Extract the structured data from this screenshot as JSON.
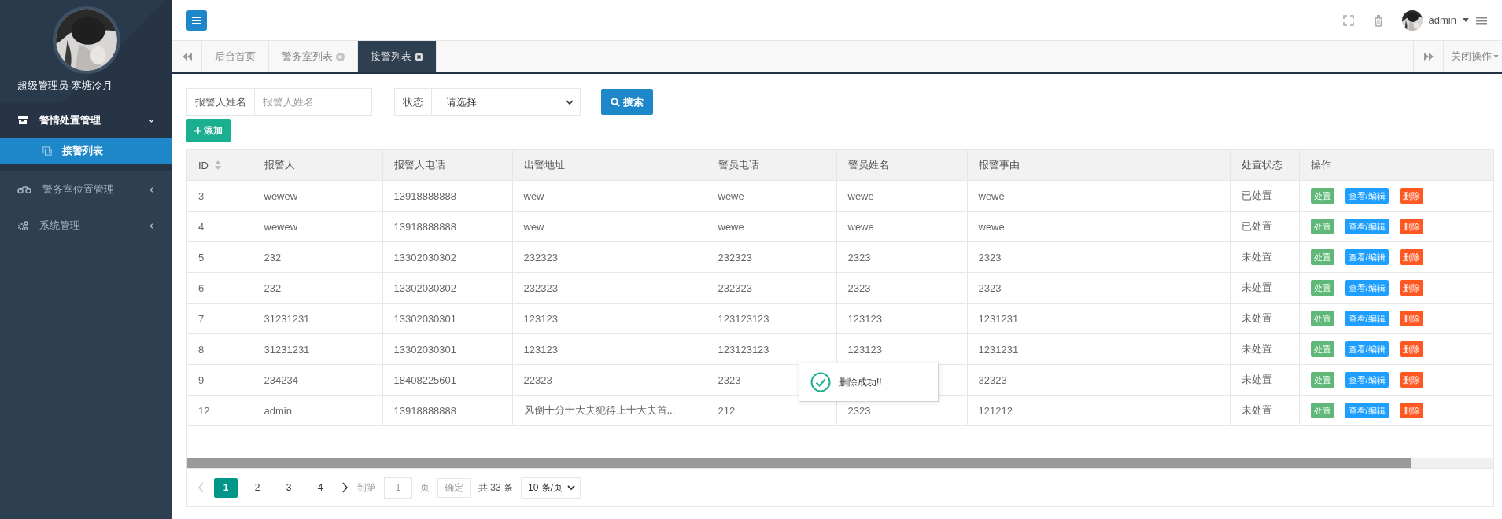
{
  "sidebar": {
    "user_name": "超级管理员-寒塘冷月",
    "menu": [
      {
        "label": "警情处置管理",
        "expanded": true,
        "children": [
          {
            "label": "接警列表",
            "selected": true
          }
        ]
      },
      {
        "label": "警务室位置管理",
        "expanded": false
      },
      {
        "label": "系统管理",
        "expanded": false
      }
    ]
  },
  "header": {
    "user": "admin"
  },
  "tabs": [
    {
      "label": "后台首页",
      "selected": false,
      "closable": false
    },
    {
      "label": "警务室列表",
      "selected": false,
      "closable": true
    },
    {
      "label": "接警列表",
      "selected": true,
      "closable": true
    }
  ],
  "tab_actions": "关闭操作",
  "filters": {
    "name_label": "报警人姓名",
    "name_placeholder": "报警人姓名",
    "status_label": "状态",
    "status_value": "请选择",
    "search_button": "搜索",
    "add_button": "添加"
  },
  "table": {
    "columns": [
      "ID",
      "报警人",
      "报警人电话",
      "出警地址",
      "警员电话",
      "警员姓名",
      "报警事由",
      "处置状态",
      "操作"
    ],
    "rows": [
      {
        "id": "3",
        "reporter": "wewew",
        "reporter_phone": "13918888888",
        "address": "wew",
        "officer_phone": "wewe",
        "officer_name": "wewe",
        "reason": "wewe",
        "status": "已处置",
        "actions": [
          {
            "label": "处置",
            "kind": "process"
          },
          {
            "label": "查看/编辑",
            "kind": "edit"
          },
          {
            "label": "删除",
            "kind": "delete"
          }
        ]
      },
      {
        "id": "4",
        "reporter": "wewew",
        "reporter_phone": "13918888888",
        "address": "wew",
        "officer_phone": "wewe",
        "officer_name": "wewe",
        "reason": "wewe",
        "status": "已处置",
        "actions": [
          {
            "label": "处置",
            "kind": "process"
          },
          {
            "label": "查看/编辑",
            "kind": "edit"
          },
          {
            "label": "删除",
            "kind": "delete"
          }
        ]
      },
      {
        "id": "5",
        "reporter": "232",
        "reporter_phone": "13302030302",
        "address": "232323",
        "officer_phone": "232323",
        "officer_name": "2323",
        "reason": "2323",
        "status": "未处置",
        "actions": [
          {
            "label": "处置",
            "kind": "process"
          },
          {
            "label": "查看/编辑",
            "kind": "edit"
          },
          {
            "label": "删除",
            "kind": "delete"
          }
        ]
      },
      {
        "id": "6",
        "reporter": "232",
        "reporter_phone": "13302030302",
        "address": "232323",
        "officer_phone": "232323",
        "officer_name": "2323",
        "reason": "2323",
        "status": "未处置",
        "actions": [
          {
            "label": "处置",
            "kind": "process"
          },
          {
            "label": "查看/编辑",
            "kind": "edit"
          },
          {
            "label": "删除",
            "kind": "delete"
          }
        ]
      },
      {
        "id": "7",
        "reporter": "31231231",
        "reporter_phone": "13302030301",
        "address": "123123",
        "officer_phone": "123123123",
        "officer_name": "123123",
        "reason": "1231231",
        "status": "未处置",
        "actions": [
          {
            "label": "处置",
            "kind": "process"
          },
          {
            "label": "查看/编辑",
            "kind": "edit"
          },
          {
            "label": "删除",
            "kind": "delete"
          }
        ]
      },
      {
        "id": "8",
        "reporter": "31231231",
        "reporter_phone": "13302030301",
        "address": "123123",
        "officer_phone": "123123123",
        "officer_name": "123123",
        "reason": "1231231",
        "status": "未处置",
        "actions": [
          {
            "label": "处置",
            "kind": "process"
          },
          {
            "label": "查看/编辑",
            "kind": "edit"
          },
          {
            "label": "删除",
            "kind": "delete"
          }
        ]
      },
      {
        "id": "9",
        "reporter": "234234",
        "reporter_phone": "18408225601",
        "address": "22323",
        "officer_phone": "2323",
        "reason": "32323",
        "status": "未处置",
        "actions": [
          {
            "label": "处置",
            "kind": "process"
          },
          {
            "label": "查看/编辑",
            "kind": "edit"
          },
          {
            "label": "删除",
            "kind": "delete"
          }
        ]
      },
      {
        "id": "12",
        "reporter": "admin",
        "reporter_phone": "13918888888",
        "address": "风倒十分士大夫犯得上士大夫首...",
        "officer_phone": "212",
        "officer_name": "2323",
        "reason": "121212",
        "status": "未处置",
        "actions": [
          {
            "label": "处置",
            "kind": "process"
          },
          {
            "label": "查看/编辑",
            "kind": "edit"
          },
          {
            "label": "删除",
            "kind": "delete"
          }
        ]
      }
    ]
  },
  "pagination": {
    "pages": [
      {
        "label": "1",
        "selected": true
      },
      {
        "label": "2",
        "selected": false
      },
      {
        "label": "3",
        "selected": false
      },
      {
        "label": "4",
        "selected": false
      }
    ],
    "goto_label": "到第",
    "goto_value": "1",
    "page_unit": "页",
    "confirm": "确定",
    "total": "共 33 条",
    "page_size": "10 条/页"
  },
  "toast": {
    "message": "删除成功!!"
  }
}
